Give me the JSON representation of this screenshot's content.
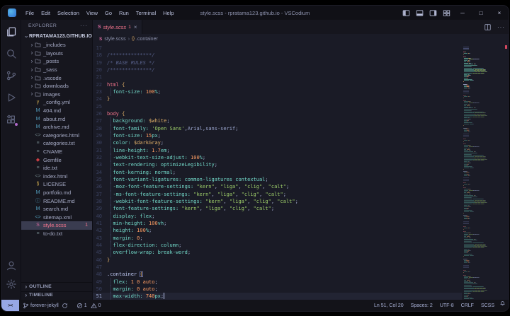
{
  "window": {
    "title": "style.scss - rpratama123.github.io - VSCodium"
  },
  "menu_bar": {
    "items": [
      "File",
      "Edit",
      "Selection",
      "View",
      "Go",
      "Run",
      "Terminal",
      "Help"
    ]
  },
  "activity_bar": {
    "top": [
      {
        "icon": "files-icon",
        "active": true
      },
      {
        "icon": "search-icon"
      },
      {
        "icon": "source-control-icon"
      },
      {
        "icon": "run-debug-icon"
      },
      {
        "icon": "extensions-icon",
        "badge": true
      }
    ],
    "bottom": [
      {
        "icon": "accounts-icon"
      },
      {
        "icon": "settings-gear-icon"
      }
    ]
  },
  "sidebar": {
    "title": "EXPLORER",
    "more_label": "···",
    "root": {
      "label": "RPRATAMA123.GITHUB.IO",
      "expanded": true
    },
    "items": [
      {
        "label": "_includes",
        "kind": "folder"
      },
      {
        "label": "_layouts",
        "kind": "folder"
      },
      {
        "label": "_posts",
        "kind": "folder"
      },
      {
        "label": "_sass",
        "kind": "folder"
      },
      {
        "label": ".vscode",
        "kind": "folder"
      },
      {
        "label": "downloads",
        "kind": "folder"
      },
      {
        "label": "images",
        "kind": "folder"
      },
      {
        "label": "_config.yml",
        "kind": "yml"
      },
      {
        "label": "404.md",
        "kind": "md"
      },
      {
        "label": "about.md",
        "kind": "md"
      },
      {
        "label": "archive.md",
        "kind": "md"
      },
      {
        "label": "categories.html",
        "kind": "html"
      },
      {
        "label": "categories.txt",
        "kind": "txt"
      },
      {
        "label": "CNAME",
        "kind": "plain"
      },
      {
        "label": "Gemfile",
        "kind": "gem"
      },
      {
        "label": "ide.txt",
        "kind": "txt"
      },
      {
        "label": "index.html",
        "kind": "html"
      },
      {
        "label": "LICENSE",
        "kind": "license"
      },
      {
        "label": "portfolio.md",
        "kind": "md"
      },
      {
        "label": "README.md",
        "kind": "info"
      },
      {
        "label": "search.md",
        "kind": "md"
      },
      {
        "label": "sitemap.xml",
        "kind": "xml"
      },
      {
        "label": "style.scss",
        "kind": "scss",
        "selected": true,
        "error": true,
        "badge": "1"
      },
      {
        "label": "to-do.txt",
        "kind": "txt"
      }
    ],
    "panels": [
      {
        "label": "OUTLINE"
      },
      {
        "label": "TIMELINE"
      }
    ]
  },
  "editor": {
    "tab": {
      "label": "style.scss",
      "badge": "1",
      "close": "×",
      "icon": "scss"
    },
    "breadcrumb": {
      "file": "style.scss",
      "separator": "›",
      "symbol": ".container"
    },
    "cursor": {
      "line": 51,
      "col": 20
    },
    "lines": [
      [
        17,
        []
      ],
      [
        18,
        [
          [
            "c",
            "/**************/"
          ]
        ]
      ],
      [
        19,
        [
          [
            "c",
            "/* BASE RULES */"
          ]
        ]
      ],
      [
        20,
        [
          [
            "c",
            "/**************/"
          ]
        ]
      ],
      [
        21,
        []
      ],
      [
        22,
        [
          [
            "t",
            "html"
          ],
          [
            "pu",
            " "
          ],
          [
            "b",
            "{"
          ]
        ]
      ],
      [
        23,
        [
          [
            "pu",
            "  "
          ],
          [
            "p",
            "font-size:"
          ],
          [
            "pu",
            " "
          ],
          [
            "n",
            "100"
          ],
          [
            "u",
            "%"
          ],
          [
            "pu",
            ";"
          ]
        ]
      ],
      [
        24,
        [
          [
            "b",
            "}"
          ]
        ]
      ],
      [
        25,
        []
      ],
      [
        26,
        [
          [
            "t",
            "body"
          ],
          [
            "pu",
            " "
          ],
          [
            "b",
            "{"
          ]
        ]
      ],
      [
        27,
        [
          [
            "pu",
            "  "
          ],
          [
            "p",
            "background:"
          ],
          [
            "pu",
            " "
          ],
          [
            "v",
            "$white"
          ],
          [
            "pu",
            ";"
          ]
        ]
      ],
      [
        28,
        [
          [
            "pu",
            "  "
          ],
          [
            "p",
            "font-family:"
          ],
          [
            "pu",
            " "
          ],
          [
            "s",
            "'Open Sans'"
          ],
          [
            "pu",
            ","
          ],
          [
            "fn",
            "Arial"
          ],
          [
            "pu",
            ","
          ],
          [
            "fn",
            "sans-serif"
          ],
          [
            "pu",
            ";"
          ]
        ]
      ],
      [
        29,
        [
          [
            "pu",
            "  "
          ],
          [
            "p",
            "font-size:"
          ],
          [
            "pu",
            " "
          ],
          [
            "n",
            "15"
          ],
          [
            "u",
            "px"
          ],
          [
            "pu",
            ";"
          ]
        ]
      ],
      [
        30,
        [
          [
            "pu",
            "  "
          ],
          [
            "p",
            "color:"
          ],
          [
            "pu",
            " "
          ],
          [
            "v",
            "$darkGray"
          ],
          [
            "pu",
            ";"
          ]
        ]
      ],
      [
        31,
        [
          [
            "pu",
            "  "
          ],
          [
            "p",
            "line-height:"
          ],
          [
            "pu",
            " "
          ],
          [
            "n",
            "1.7"
          ],
          [
            "u",
            "em"
          ],
          [
            "pu",
            ";"
          ]
        ]
      ],
      [
        32,
        [
          [
            "pu",
            "  "
          ],
          [
            "p",
            "-webkit-text-size-adjust:"
          ],
          [
            "pu",
            " "
          ],
          [
            "n",
            "100"
          ],
          [
            "u",
            "%"
          ],
          [
            "pu",
            ";"
          ]
        ]
      ],
      [
        33,
        [
          [
            "pu",
            "  "
          ],
          [
            "p",
            "text-rendering:"
          ],
          [
            "pu",
            " "
          ],
          [
            "k",
            "optimizeLegibility"
          ],
          [
            "pu",
            ";"
          ]
        ]
      ],
      [
        34,
        [
          [
            "pu",
            "  "
          ],
          [
            "p",
            "font-kerning:"
          ],
          [
            "pu",
            " "
          ],
          [
            "k",
            "normal"
          ],
          [
            "pu",
            ";"
          ]
        ]
      ],
      [
        35,
        [
          [
            "pu",
            "  "
          ],
          [
            "p",
            "font-variant-ligatures:"
          ],
          [
            "pu",
            " "
          ],
          [
            "k",
            "common-ligatures"
          ],
          [
            "pu",
            " "
          ],
          [
            "k",
            "contextual"
          ],
          [
            "pu",
            ";"
          ]
        ]
      ],
      [
        36,
        [
          [
            "pu",
            "  "
          ],
          [
            "p",
            "-moz-font-feature-settings:"
          ],
          [
            "pu",
            " "
          ],
          [
            "s",
            "\"kern\""
          ],
          [
            "pu",
            ", "
          ],
          [
            "s",
            "\"liga\""
          ],
          [
            "pu",
            ", "
          ],
          [
            "s",
            "\"clig\""
          ],
          [
            "pu",
            ", "
          ],
          [
            "s",
            "\"calt\""
          ],
          [
            "pu",
            ";"
          ]
        ]
      ],
      [
        37,
        [
          [
            "pu",
            "  "
          ],
          [
            "p",
            "-ms-font-feature-settings:"
          ],
          [
            "pu",
            " "
          ],
          [
            "s",
            "\"kern\""
          ],
          [
            "pu",
            ", "
          ],
          [
            "s",
            "\"liga\""
          ],
          [
            "pu",
            ", "
          ],
          [
            "s",
            "\"clig\""
          ],
          [
            "pu",
            ", "
          ],
          [
            "s",
            "\"calt\""
          ],
          [
            "pu",
            ";"
          ]
        ]
      ],
      [
        38,
        [
          [
            "pu",
            "  "
          ],
          [
            "p",
            "-webkit-font-feature-settings:"
          ],
          [
            "pu",
            " "
          ],
          [
            "s",
            "\"kern\""
          ],
          [
            "pu",
            ", "
          ],
          [
            "s",
            "\"liga\""
          ],
          [
            "pu",
            ", "
          ],
          [
            "s",
            "\"clig\""
          ],
          [
            "pu",
            ", "
          ],
          [
            "s",
            "\"calt\""
          ],
          [
            "pu",
            ";"
          ]
        ]
      ],
      [
        39,
        [
          [
            "pu",
            "  "
          ],
          [
            "p",
            "font-feature-settings:"
          ],
          [
            "pu",
            " "
          ],
          [
            "s",
            "\"kern\""
          ],
          [
            "pu",
            ", "
          ],
          [
            "s",
            "\"liga\""
          ],
          [
            "pu",
            ", "
          ],
          [
            "s",
            "\"clig\""
          ],
          [
            "pu",
            ", "
          ],
          [
            "s",
            "\"calt\""
          ],
          [
            "pu",
            ";"
          ]
        ]
      ],
      [
        40,
        [
          [
            "pu",
            "  "
          ],
          [
            "p",
            "display:"
          ],
          [
            "pu",
            " "
          ],
          [
            "k",
            "flex"
          ],
          [
            "pu",
            ";"
          ]
        ]
      ],
      [
        41,
        [
          [
            "pu",
            "  "
          ],
          [
            "p",
            "min-height:"
          ],
          [
            "pu",
            " "
          ],
          [
            "n",
            "100"
          ],
          [
            "u",
            "vh"
          ],
          [
            "pu",
            ";"
          ]
        ]
      ],
      [
        42,
        [
          [
            "pu",
            "  "
          ],
          [
            "p",
            "height:"
          ],
          [
            "pu",
            " "
          ],
          [
            "n",
            "100"
          ],
          [
            "u",
            "%"
          ],
          [
            "pu",
            ";"
          ]
        ]
      ],
      [
        43,
        [
          [
            "pu",
            "  "
          ],
          [
            "p",
            "margin:"
          ],
          [
            "pu",
            " "
          ],
          [
            "n",
            "0"
          ],
          [
            "pu",
            ";"
          ]
        ]
      ],
      [
        44,
        [
          [
            "pu",
            "  "
          ],
          [
            "p",
            "flex-direction:"
          ],
          [
            "pu",
            " "
          ],
          [
            "k",
            "column"
          ],
          [
            "pu",
            ";"
          ]
        ]
      ],
      [
        45,
        [
          [
            "pu",
            "  "
          ],
          [
            "p",
            "overflow-wrap:"
          ],
          [
            "pu",
            " "
          ],
          [
            "k",
            "break-word"
          ],
          [
            "pu",
            ";"
          ]
        ]
      ],
      [
        46,
        [
          [
            "b",
            "}"
          ]
        ]
      ],
      [
        47,
        []
      ],
      [
        48,
        [
          [
            "cl",
            ".container"
          ],
          [
            "pu",
            " "
          ],
          [
            "bm",
            "{"
          ]
        ]
      ],
      [
        49,
        [
          [
            "pu",
            "  "
          ],
          [
            "p",
            "flex:"
          ],
          [
            "pu",
            " "
          ],
          [
            "n",
            "1"
          ],
          [
            "pu",
            " "
          ],
          [
            "n",
            "0"
          ],
          [
            "pu",
            " "
          ],
          [
            "o",
            "auto"
          ],
          [
            "pu",
            ";"
          ]
        ]
      ],
      [
        50,
        [
          [
            "pu",
            "  "
          ],
          [
            "p",
            "margin:"
          ],
          [
            "pu",
            " "
          ],
          [
            "n",
            "0"
          ],
          [
            "pu",
            " "
          ],
          [
            "o",
            "auto"
          ],
          [
            "pu",
            ";"
          ]
        ]
      ],
      [
        51,
        [
          [
            "pu",
            "  "
          ],
          [
            "p",
            "max-width:"
          ],
          [
            "pu",
            " "
          ],
          [
            "n",
            "740"
          ],
          [
            "u",
            "px"
          ],
          [
            "pu",
            ";"
          ]
        ]
      ]
    ]
  },
  "status_bar": {
    "branch": "forever-jekyll",
    "errors": "1",
    "warnings": "0",
    "right_items": [
      "Ln 51, Col 20",
      "Spaces: 2",
      "UTF-8",
      "CRLF",
      "SCSS"
    ]
  },
  "colors": {
    "error_red": "#f7768e",
    "remote_accent": "#97a7e6",
    "sass_pink": "#cd6799",
    "editor_bg": "#1a1b26",
    "panel_bg": "#16161e"
  }
}
